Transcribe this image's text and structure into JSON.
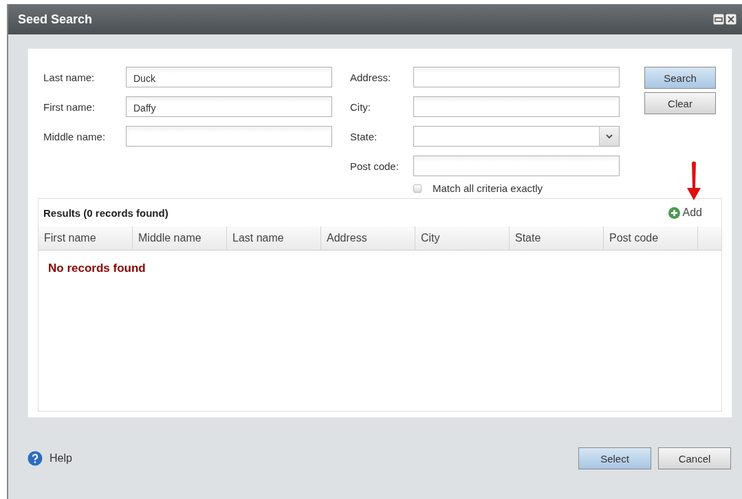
{
  "window": {
    "title": "Seed Search"
  },
  "form": {
    "left_fields": [
      {
        "label": "Last name:",
        "value": "Duck",
        "kind": "text"
      },
      {
        "label": "First name:",
        "value": "Daffy",
        "kind": "text"
      },
      {
        "label": "Middle name:",
        "kind": "text"
      }
    ],
    "right_fields": [
      {
        "label": "Address:",
        "kind": "text"
      },
      {
        "label": "City:",
        "kind": "text"
      },
      {
        "label": "State:",
        "kind": "select"
      },
      {
        "label": "Post code:",
        "kind": "text"
      }
    ],
    "match_exactly": {
      "label": "Match all criteria exactly",
      "checked": false
    },
    "buttons": [
      {
        "label": "Search",
        "primary": true
      },
      {
        "label": "Clear",
        "primary": false
      }
    ]
  },
  "results": {
    "title": "Results (0 records found)",
    "add_label": "Add",
    "columns": [
      "First name",
      "Middle name",
      "Last name",
      "Address",
      "City",
      "State",
      "Post code"
    ],
    "empty_message": "No records found"
  },
  "footer": {
    "help": "Help",
    "buttons": [
      {
        "label": "Select",
        "primary": true
      },
      {
        "label": "Cancel",
        "primary": false
      }
    ]
  }
}
